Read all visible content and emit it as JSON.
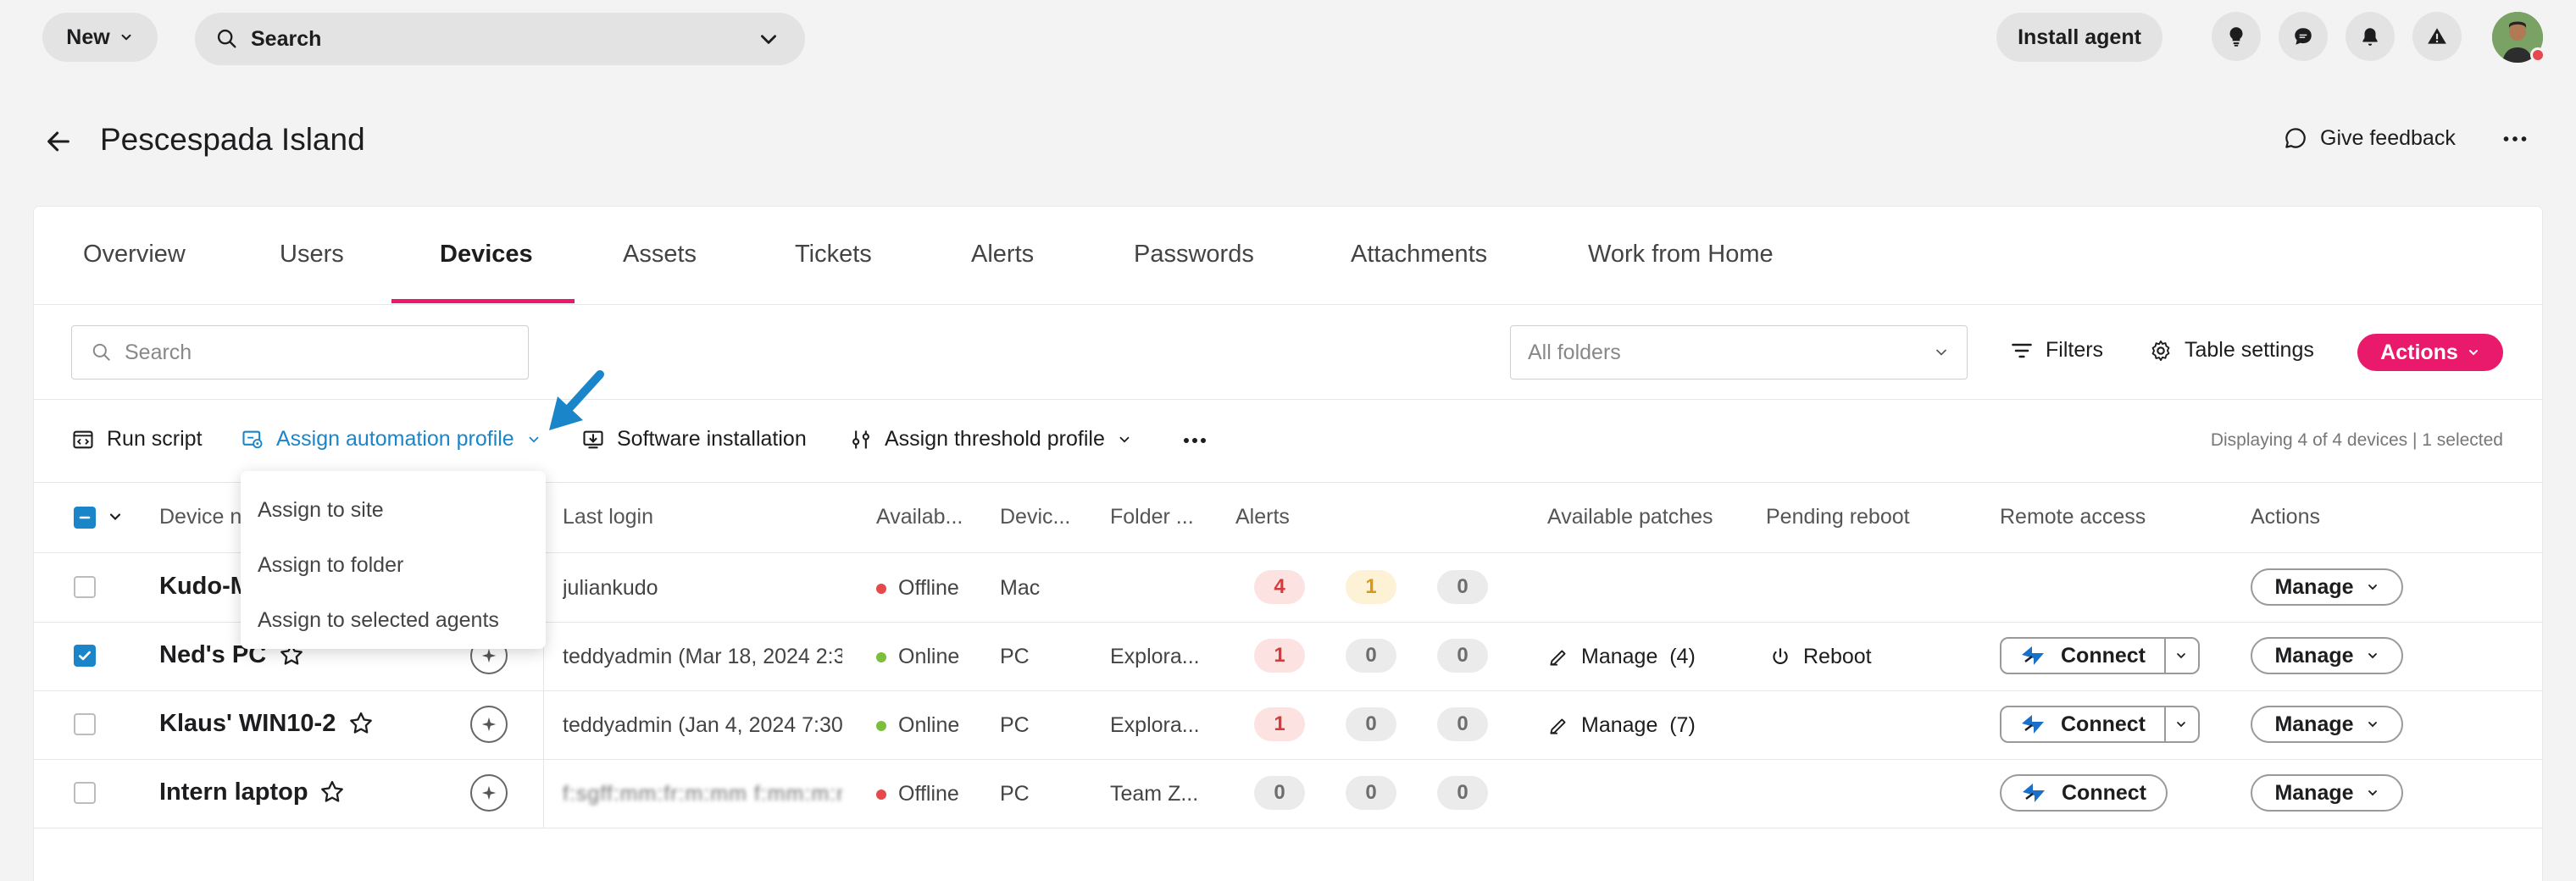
{
  "topbar": {
    "new_label": "New",
    "search_label": "Search",
    "install_agent_label": "Install agent",
    "icons": [
      "lightbulb-icon",
      "chat-icon",
      "bell-icon",
      "warning-icon"
    ]
  },
  "header": {
    "title": "Pescespada Island",
    "feedback_label": "Give feedback"
  },
  "tabs": [
    {
      "label": "Overview"
    },
    {
      "label": "Users"
    },
    {
      "label": "Devices",
      "active": true
    },
    {
      "label": "Assets"
    },
    {
      "label": "Tickets"
    },
    {
      "label": "Alerts"
    },
    {
      "label": "Passwords"
    },
    {
      "label": "Attachments"
    },
    {
      "label": "Work from Home"
    }
  ],
  "filterbar": {
    "search_placeholder": "Search",
    "folder_placeholder": "All folders",
    "filters_label": "Filters",
    "table_settings_label": "Table settings",
    "actions_label": "Actions"
  },
  "actionbar": {
    "run_script": "Run script",
    "assign_automation": "Assign automation profile",
    "software_installation": "Software installation",
    "assign_threshold": "Assign threshold profile",
    "display_count": "Displaying 4 of 4 devices | 1 selected"
  },
  "dropdown": {
    "options": [
      "Assign to site",
      "Assign to folder",
      "Assign to selected agents"
    ]
  },
  "table": {
    "headers": {
      "device_name": "Device n",
      "last_login": "Last login",
      "availability": "Availab...",
      "device_type": "Devic...",
      "folder": "Folder ...",
      "alerts": "Alerts",
      "patches": "Available patches",
      "pending_reboot": "Pending reboot",
      "remote_access": "Remote access",
      "actions": "Actions"
    },
    "rows": [
      {
        "name": "Kudo-M",
        "last_login": "juliankudo",
        "status": "Offline",
        "type": "Mac",
        "folder": "",
        "alerts": [
          "4",
          "1",
          "0"
        ],
        "patches": "",
        "reboot": "",
        "connect": "",
        "manage": "Manage"
      },
      {
        "name": "Ned's PC",
        "last_login": "teddyadmin (Mar 18, 2024 2:3",
        "status": "Online",
        "type": "PC",
        "folder": "Explora...",
        "alerts": [
          "1",
          "0",
          "0"
        ],
        "patches": "Manage  (4)",
        "reboot": "Reboot",
        "connect": "Connect",
        "manage": "Manage"
      },
      {
        "name": "Klaus' WIN10-2",
        "last_login": "teddyadmin (Jan 4, 2024 7:30",
        "status": "Online",
        "type": "PC",
        "folder": "Explora...",
        "alerts": [
          "1",
          "0",
          "0"
        ],
        "patches": "Manage  (7)",
        "reboot": "",
        "connect": "Connect",
        "manage": "Manage"
      },
      {
        "name": "Intern laptop",
        "last_login": "f:sgff:mm:fr:m:mm f:mm:m:mm ff:mm: f f:",
        "status": "Offline",
        "type": "PC",
        "folder": "Team Z...",
        "alerts": [
          "0",
          "0",
          "0"
        ],
        "patches": "",
        "reboot": "",
        "connect": "Connect",
        "manage": "Manage"
      }
    ]
  },
  "colors": {
    "accent": "#e9196b",
    "link_blue": "#1a86c9",
    "online": "#7cbf3a",
    "offline": "#e5484d"
  }
}
